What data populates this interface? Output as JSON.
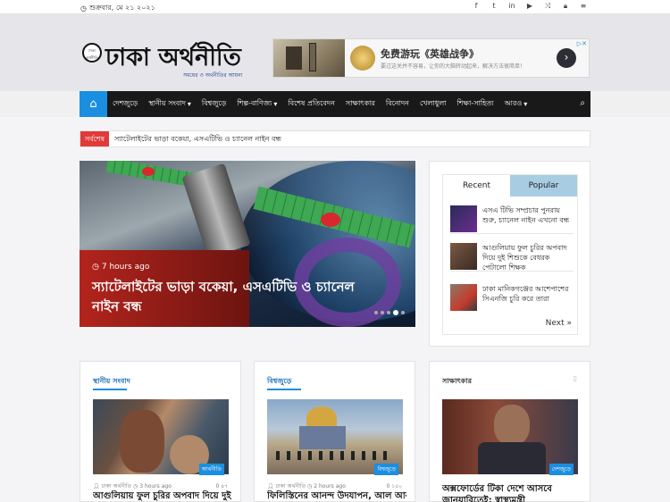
{
  "topbar": {
    "date": "শুক্রবার, মে ২১ ২০২১",
    "social_icons": [
      "facebook-icon",
      "twitter-icon",
      "vk-icon",
      "youtube-icon",
      "shuffle-icon",
      "lock-icon",
      "menu-icon"
    ]
  },
  "site": {
    "logo_name": "ঢাকা অর্থনীতি",
    "tagline": "সময়ের ও অর্থনীতির আয়না"
  },
  "ad": {
    "title": "免费游玩《英雄战争》",
    "subtitle": "要过这关并不容易，让你的大脑转动起来，解决方法很简单！",
    "adchoices": "▷✕"
  },
  "nav": {
    "items": [
      {
        "label": "দেশজুড়ে",
        "dropdown": false
      },
      {
        "label": "স্থানীয় সংবাদ",
        "dropdown": true
      },
      {
        "label": "বিশ্বজুড়ে",
        "dropdown": false
      },
      {
        "label": "শিল্প-বাণিজ্য",
        "dropdown": true
      },
      {
        "label": "বিশেষ প্রতিবেদন",
        "dropdown": false
      },
      {
        "label": "সাক্ষাৎকার",
        "dropdown": false
      },
      {
        "label": "বিনোদন",
        "dropdown": false
      },
      {
        "label": "খেলাধুলা",
        "dropdown": false
      },
      {
        "label": "শিক্ষা-সাহিত্য",
        "dropdown": false
      },
      {
        "label": "আরও",
        "dropdown": true
      }
    ]
  },
  "breaking": {
    "label": "সর্বশেষ",
    "text": "স্যাটেলাইটের ভাড়া বকেয়া, এসএটিভি ও চ্যানেল নাইন বন্ধ"
  },
  "hero": {
    "time": "7 hours ago",
    "headline": "স্যাটেলাইটের ভাড়া বকেয়া, এসএটিভি ও চ্যানেল নাইন বন্ধ"
  },
  "sidebar": {
    "tabs": [
      "Recent",
      "Popular"
    ],
    "items": [
      "এসএ টিভি সম্প্রচার পুনরায় শুরু, চ্যানেল নাইন এখনো বন্ধ",
      "আগুলিয়ায় ফুল চুরির অপবাদ দিয়ে দুই শিশুকে বেধরক পেটালো শিক্ষক",
      "ঢাকা মানিকগঞ্জের আশেপাশের সিএনজি চুরি করে তারা"
    ],
    "next": "Next »"
  },
  "cards": [
    {
      "section": "স্থানীয় সংবাদ",
      "tag": "আর্থনীতি",
      "author": "ঢাকা অর্থনীতি",
      "time": "3 hours ago",
      "stats": "0  ৪৭",
      "title": "আগুলিয়ায় ফুল চুরির অপবাদ দিয়ে দুই"
    },
    {
      "section": "বিশ্বজুড়ে",
      "tag": "বিশ্বজুড়ে",
      "author": "ঢাকা অর্থনীতি",
      "time": "2 hours ago",
      "stats": "0  ১৫০",
      "title": "ফিলিস্তিনের আনন্দ উদযাপন, আল আকসায়"
    },
    {
      "section": "সাক্ষাৎকার",
      "tag": "দেশজুড়ে",
      "author": "",
      "time": "",
      "stats": "",
      "title": "অক্সফোর্ডের টিকা দেশে আসবে জানুয়ারিতেই: স্বাস্থ্যমন্ত্রী"
    }
  ],
  "colors": {
    "accent": "#1a8ee0",
    "breaking": "#e03a3a",
    "nav_bg": "#191919",
    "popular_tab": "#a8cde3"
  }
}
